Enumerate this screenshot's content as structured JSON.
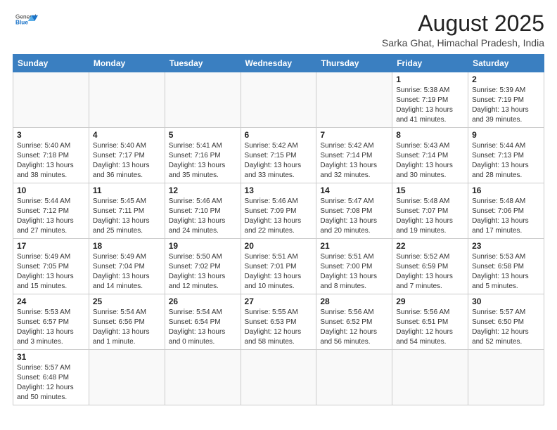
{
  "logo": {
    "text_general": "General",
    "text_blue": "Blue"
  },
  "title": "August 2025",
  "subtitle": "Sarka Ghat, Himachal Pradesh, India",
  "weekdays": [
    "Sunday",
    "Monday",
    "Tuesday",
    "Wednesday",
    "Thursday",
    "Friday",
    "Saturday"
  ],
  "weeks": [
    [
      {
        "day": "",
        "info": ""
      },
      {
        "day": "",
        "info": ""
      },
      {
        "day": "",
        "info": ""
      },
      {
        "day": "",
        "info": ""
      },
      {
        "day": "",
        "info": ""
      },
      {
        "day": "1",
        "info": "Sunrise: 5:38 AM\nSunset: 7:19 PM\nDaylight: 13 hours and 41 minutes."
      },
      {
        "day": "2",
        "info": "Sunrise: 5:39 AM\nSunset: 7:19 PM\nDaylight: 13 hours and 39 minutes."
      }
    ],
    [
      {
        "day": "3",
        "info": "Sunrise: 5:40 AM\nSunset: 7:18 PM\nDaylight: 13 hours and 38 minutes."
      },
      {
        "day": "4",
        "info": "Sunrise: 5:40 AM\nSunset: 7:17 PM\nDaylight: 13 hours and 36 minutes."
      },
      {
        "day": "5",
        "info": "Sunrise: 5:41 AM\nSunset: 7:16 PM\nDaylight: 13 hours and 35 minutes."
      },
      {
        "day": "6",
        "info": "Sunrise: 5:42 AM\nSunset: 7:15 PM\nDaylight: 13 hours and 33 minutes."
      },
      {
        "day": "7",
        "info": "Sunrise: 5:42 AM\nSunset: 7:14 PM\nDaylight: 13 hours and 32 minutes."
      },
      {
        "day": "8",
        "info": "Sunrise: 5:43 AM\nSunset: 7:14 PM\nDaylight: 13 hours and 30 minutes."
      },
      {
        "day": "9",
        "info": "Sunrise: 5:44 AM\nSunset: 7:13 PM\nDaylight: 13 hours and 28 minutes."
      }
    ],
    [
      {
        "day": "10",
        "info": "Sunrise: 5:44 AM\nSunset: 7:12 PM\nDaylight: 13 hours and 27 minutes."
      },
      {
        "day": "11",
        "info": "Sunrise: 5:45 AM\nSunset: 7:11 PM\nDaylight: 13 hours and 25 minutes."
      },
      {
        "day": "12",
        "info": "Sunrise: 5:46 AM\nSunset: 7:10 PM\nDaylight: 13 hours and 24 minutes."
      },
      {
        "day": "13",
        "info": "Sunrise: 5:46 AM\nSunset: 7:09 PM\nDaylight: 13 hours and 22 minutes."
      },
      {
        "day": "14",
        "info": "Sunrise: 5:47 AM\nSunset: 7:08 PM\nDaylight: 13 hours and 20 minutes."
      },
      {
        "day": "15",
        "info": "Sunrise: 5:48 AM\nSunset: 7:07 PM\nDaylight: 13 hours and 19 minutes."
      },
      {
        "day": "16",
        "info": "Sunrise: 5:48 AM\nSunset: 7:06 PM\nDaylight: 13 hours and 17 minutes."
      }
    ],
    [
      {
        "day": "17",
        "info": "Sunrise: 5:49 AM\nSunset: 7:05 PM\nDaylight: 13 hours and 15 minutes."
      },
      {
        "day": "18",
        "info": "Sunrise: 5:49 AM\nSunset: 7:04 PM\nDaylight: 13 hours and 14 minutes."
      },
      {
        "day": "19",
        "info": "Sunrise: 5:50 AM\nSunset: 7:02 PM\nDaylight: 13 hours and 12 minutes."
      },
      {
        "day": "20",
        "info": "Sunrise: 5:51 AM\nSunset: 7:01 PM\nDaylight: 13 hours and 10 minutes."
      },
      {
        "day": "21",
        "info": "Sunrise: 5:51 AM\nSunset: 7:00 PM\nDaylight: 13 hours and 8 minutes."
      },
      {
        "day": "22",
        "info": "Sunrise: 5:52 AM\nSunset: 6:59 PM\nDaylight: 13 hours and 7 minutes."
      },
      {
        "day": "23",
        "info": "Sunrise: 5:53 AM\nSunset: 6:58 PM\nDaylight: 13 hours and 5 minutes."
      }
    ],
    [
      {
        "day": "24",
        "info": "Sunrise: 5:53 AM\nSunset: 6:57 PM\nDaylight: 13 hours and 3 minutes."
      },
      {
        "day": "25",
        "info": "Sunrise: 5:54 AM\nSunset: 6:56 PM\nDaylight: 13 hours and 1 minute."
      },
      {
        "day": "26",
        "info": "Sunrise: 5:54 AM\nSunset: 6:54 PM\nDaylight: 13 hours and 0 minutes."
      },
      {
        "day": "27",
        "info": "Sunrise: 5:55 AM\nSunset: 6:53 PM\nDaylight: 12 hours and 58 minutes."
      },
      {
        "day": "28",
        "info": "Sunrise: 5:56 AM\nSunset: 6:52 PM\nDaylight: 12 hours and 56 minutes."
      },
      {
        "day": "29",
        "info": "Sunrise: 5:56 AM\nSunset: 6:51 PM\nDaylight: 12 hours and 54 minutes."
      },
      {
        "day": "30",
        "info": "Sunrise: 5:57 AM\nSunset: 6:50 PM\nDaylight: 12 hours and 52 minutes."
      }
    ],
    [
      {
        "day": "31",
        "info": "Sunrise: 5:57 AM\nSunset: 6:48 PM\nDaylight: 12 hours and 50 minutes."
      },
      {
        "day": "",
        "info": ""
      },
      {
        "day": "",
        "info": ""
      },
      {
        "day": "",
        "info": ""
      },
      {
        "day": "",
        "info": ""
      },
      {
        "day": "",
        "info": ""
      },
      {
        "day": "",
        "info": ""
      }
    ]
  ]
}
